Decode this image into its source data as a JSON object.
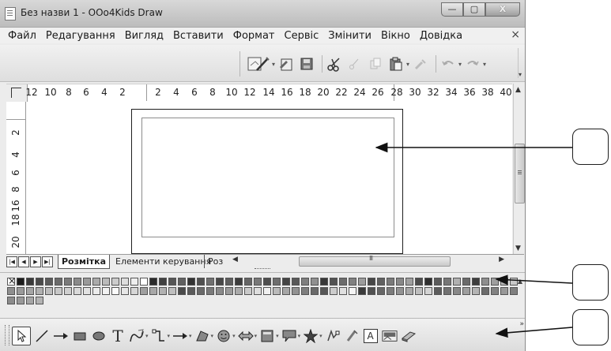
{
  "window": {
    "title": "Без назви 1 - OOo4Kids Draw",
    "buttons": {
      "minimize": "—",
      "maximize": "▢",
      "close": "X"
    },
    "doc_close": "×"
  },
  "menu": [
    "Файл",
    "Редагування",
    "Вигляд",
    "Вставити",
    "Формат",
    "Сервіс",
    "Змінити",
    "Вікно",
    "Довідка"
  ],
  "toolbar_standard": {
    "icons": [
      "draw-wand-icon",
      "edit-file-icon",
      "save-icon",
      "scissors-icon",
      "clipboard-cut-icon",
      "copy-icon",
      "paste-icon",
      "clone-brush-icon",
      "undo-icon",
      "redo-icon"
    ]
  },
  "rulers": {
    "horizontal": [
      "12",
      "10",
      "8",
      "6",
      "4",
      "2",
      "2",
      "4",
      "6",
      "8",
      "10",
      "12",
      "14",
      "16",
      "18",
      "20",
      "22",
      "24",
      "26",
      "28",
      "30",
      "32",
      "34",
      "36",
      "38",
      "40"
    ],
    "vertical": [
      "2",
      "4",
      "6",
      "8",
      "16",
      "18",
      "20"
    ]
  },
  "tabs": {
    "items": [
      "Розмітка",
      "Елементи керування",
      "Роз"
    ],
    "active": 0
  },
  "palette": {
    "colors": [
      "#1c1c1c",
      "#3a3a3a",
      "#4a4a4a",
      "#5b5b5b",
      "#6a6a6a",
      "#7a7a7a",
      "#8a8a8a",
      "#9a9a9a",
      "#aaaaaa",
      "#bbbbbb",
      "#cccccc",
      "#dddddd",
      "#eeeeee",
      "#ffffff",
      "#2a2a2a",
      "#404040",
      "#555555",
      "#606060",
      "#333333",
      "#505050",
      "#707070",
      "#484848",
      "#5e5e5e",
      "#3c3c3c",
      "#656565",
      "#787878",
      "#4e4e4e",
      "#6e6e6e",
      "#444444",
      "#585858",
      "#7e7e7e",
      "#909090",
      "#383838",
      "#525252",
      "#6c6c6c",
      "#808080",
      "#9c9c9c",
      "#474747",
      "#606060",
      "#7a7a7a",
      "#888888",
      "#a0a0a0",
      "#4c4c4c",
      "#2e2e2e",
      "#5a5a5a",
      "#767676",
      "#b0b0b0",
      "#6a6a6a",
      "#3e3e3e",
      "#8e8e8e",
      "#9e9e9e",
      "#b8b8b8",
      "#c8c8c8",
      "#8f8f8f",
      "#9a9a9a",
      "#a5a5a5",
      "#b0b0b0",
      "#bdbdbd",
      "#c8c8c8",
      "#d0d0d0",
      "#dadada",
      "#e2e2e2",
      "#ececec",
      "#f2f2f2",
      "#fafafa",
      "#e6e6e6",
      "#d6d6d6",
      "#9f9f9f",
      "#a8a8a8",
      "#b2b2b2",
      "#bebebe",
      "#4a4a4a",
      "#5a5a5a",
      "#6a6a6a",
      "#7a7a7a",
      "#8a8a8a",
      "#9a9a9a",
      "#aaaaaa",
      "#cacaca",
      "#dedede",
      "#f0f0f0",
      "#bababa",
      "#a6a6a6",
      "#929292",
      "#7e7e7e",
      "#6a6a6a",
      "#565656",
      "#cccccc",
      "#e0e0e0",
      "#f4f4f4",
      "#3a3a3a",
      "#505050",
      "#666666",
      "#7c7c7c",
      "#929292",
      "#a8a8a8",
      "#bebebe",
      "#d4d4d4",
      "#5c5c5c",
      "#727272",
      "#888888",
      "#9e9e9e",
      "#b4b4b4",
      "#6c6c6c",
      "#828282",
      "#989898",
      "#7f7f7f",
      "#8c8c8c",
      "#999999",
      "#a6a6a6",
      "#b3b3b3"
    ]
  },
  "toolbar_drawing": {
    "icons": [
      "select-arrow-icon",
      "line-icon",
      "line-arrow-icon",
      "rectangle-icon",
      "ellipse-icon",
      "text-icon",
      "curve-icon",
      "connector-icon",
      "lines-arrows-icon",
      "basic-shapes-icon",
      "symbol-shapes-icon",
      "block-arrows-icon",
      "flowchart-icon",
      "callouts-icon",
      "stars-icon",
      "points-icon",
      "glue-points-icon",
      "fontwork-icon",
      "from-file-icon",
      "extrusion-icon"
    ],
    "text_glyph": "T",
    "fontwork_glyph": "A"
  }
}
